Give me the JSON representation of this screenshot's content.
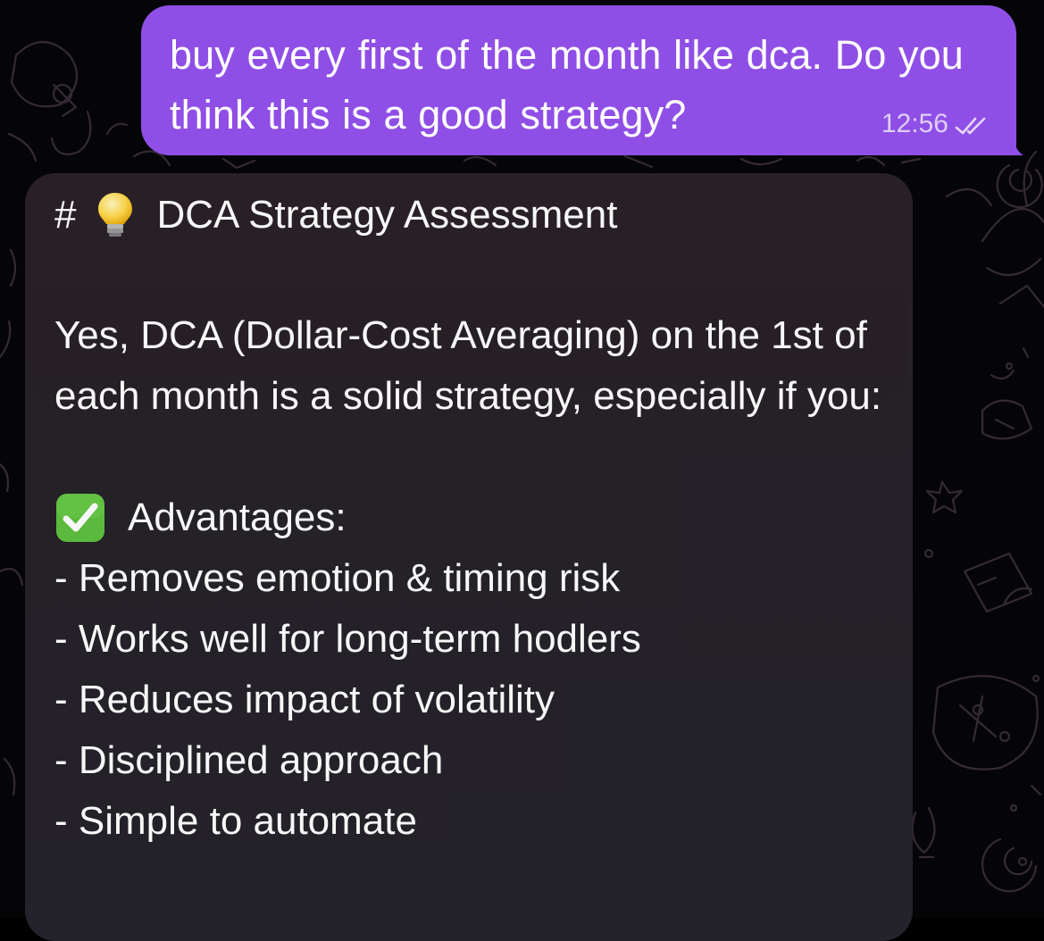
{
  "outgoing_message": {
    "text": "buy every first of the month like dca. Do you think this is a good strategy?",
    "time": "12:56",
    "status_icon": "double-check-icon"
  },
  "incoming_message": {
    "heading_prefix": "#",
    "heading_icon": "light-bulb-icon",
    "heading_text": "DCA Strategy Assessment",
    "paragraph": "Yes, DCA (Dollar-Cost Averaging) on the 1st of each month is a solid strategy, especially if you:",
    "section_icon": "check-mark-emoji-icon",
    "section_title": "Advantages:",
    "items": [
      "- Removes emotion & timing risk",
      "- Works well for long-term hodlers",
      "- Reduces impact of volatility",
      "- Disciplined approach",
      "- Simple to automate"
    ]
  },
  "colors": {
    "outgoing_bubble": "#8f4fe6",
    "incoming_bubble": "#2a2128",
    "background": "#050406",
    "check_green": "#5ec03f"
  }
}
